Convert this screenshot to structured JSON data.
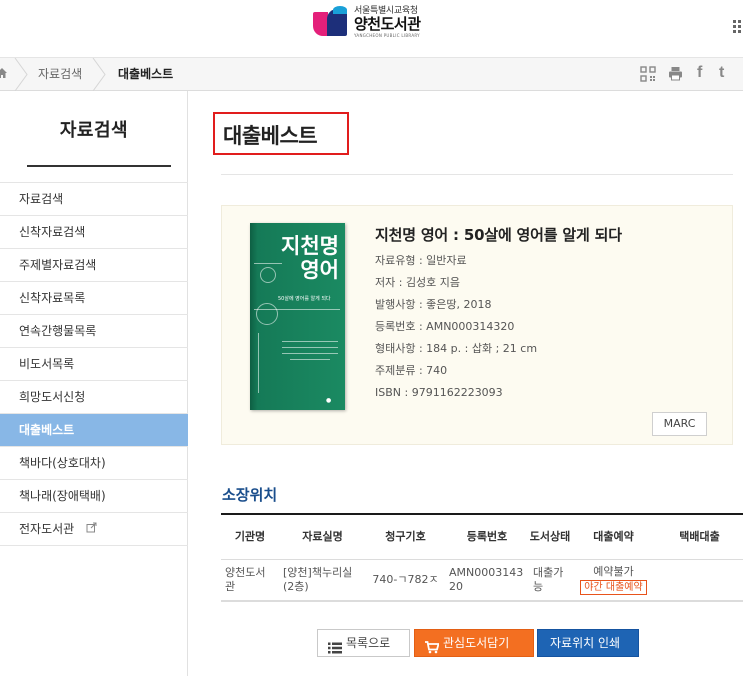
{
  "header": {
    "logo_sub": "서울특별시교육청",
    "logo_main": "양천도서관",
    "logo_eng": "YANGCHEON PUBLIC LIBRARY"
  },
  "breadcrumb": {
    "level1": "자료검색",
    "level2": "대출베스트"
  },
  "sidebar": {
    "title": "자료검색",
    "items": [
      {
        "label": "자료검색",
        "active": false
      },
      {
        "label": "신착자료검색",
        "active": false
      },
      {
        "label": "주제별자료검색",
        "active": false
      },
      {
        "label": "신착자료목록",
        "active": false
      },
      {
        "label": "연속간행물목록",
        "active": false
      },
      {
        "label": "비도서목록",
        "active": false
      },
      {
        "label": "희망도서신청",
        "active": false
      },
      {
        "label": "대출베스트",
        "active": true
      },
      {
        "label": "책바다(상호대차)",
        "active": false
      },
      {
        "label": "책나래(장애택배)",
        "active": false
      },
      {
        "label": "전자도서관",
        "active": false
      }
    ]
  },
  "main": {
    "page_title": "대출베스트",
    "book": {
      "cover_title_line1": "지천명",
      "cover_title_line2": "영어",
      "cover_subtitle": "50살에 영어를 알게 되다",
      "title": "지천명 영어 : 50살에 영어를 알게 되다",
      "meta": [
        "자료유형 : 일반자료",
        "저자 : 김성호 지음",
        "발행사항 : 좋은땅, 2018",
        "등록번호 : AMN000314320",
        "형태사항 : 184 p. : 삽화 ; 21 cm",
        "주제분류 : 740",
        "ISBN : 9791162223093"
      ],
      "marc_label": "MARC"
    },
    "location": {
      "heading": "소장위치",
      "columns": [
        "기관명",
        "자료실명",
        "청구기호",
        "등록번호",
        "도서상태",
        "대출예약",
        "택배대출"
      ],
      "row": {
        "institution": "양천도서관",
        "room": "[양천]책누리실(2층)",
        "call_no": "740-ㄱ782ㅈ",
        "reg_no": "AMN000314320",
        "status": "대출가능",
        "reservation": "예약불가",
        "night_loan": "야간 대출예약",
        "delivery": ""
      }
    },
    "buttons": {
      "list": "목록으로",
      "cart": "관심도서담기",
      "print": "자료위치 인쇄"
    }
  },
  "colors": {
    "active_menu": "#88b7e6",
    "title_highlight": "#e11d1d",
    "heading_blue": "#1a4e8c",
    "orange": "#f36f21",
    "blue_button": "#1e64b4"
  }
}
